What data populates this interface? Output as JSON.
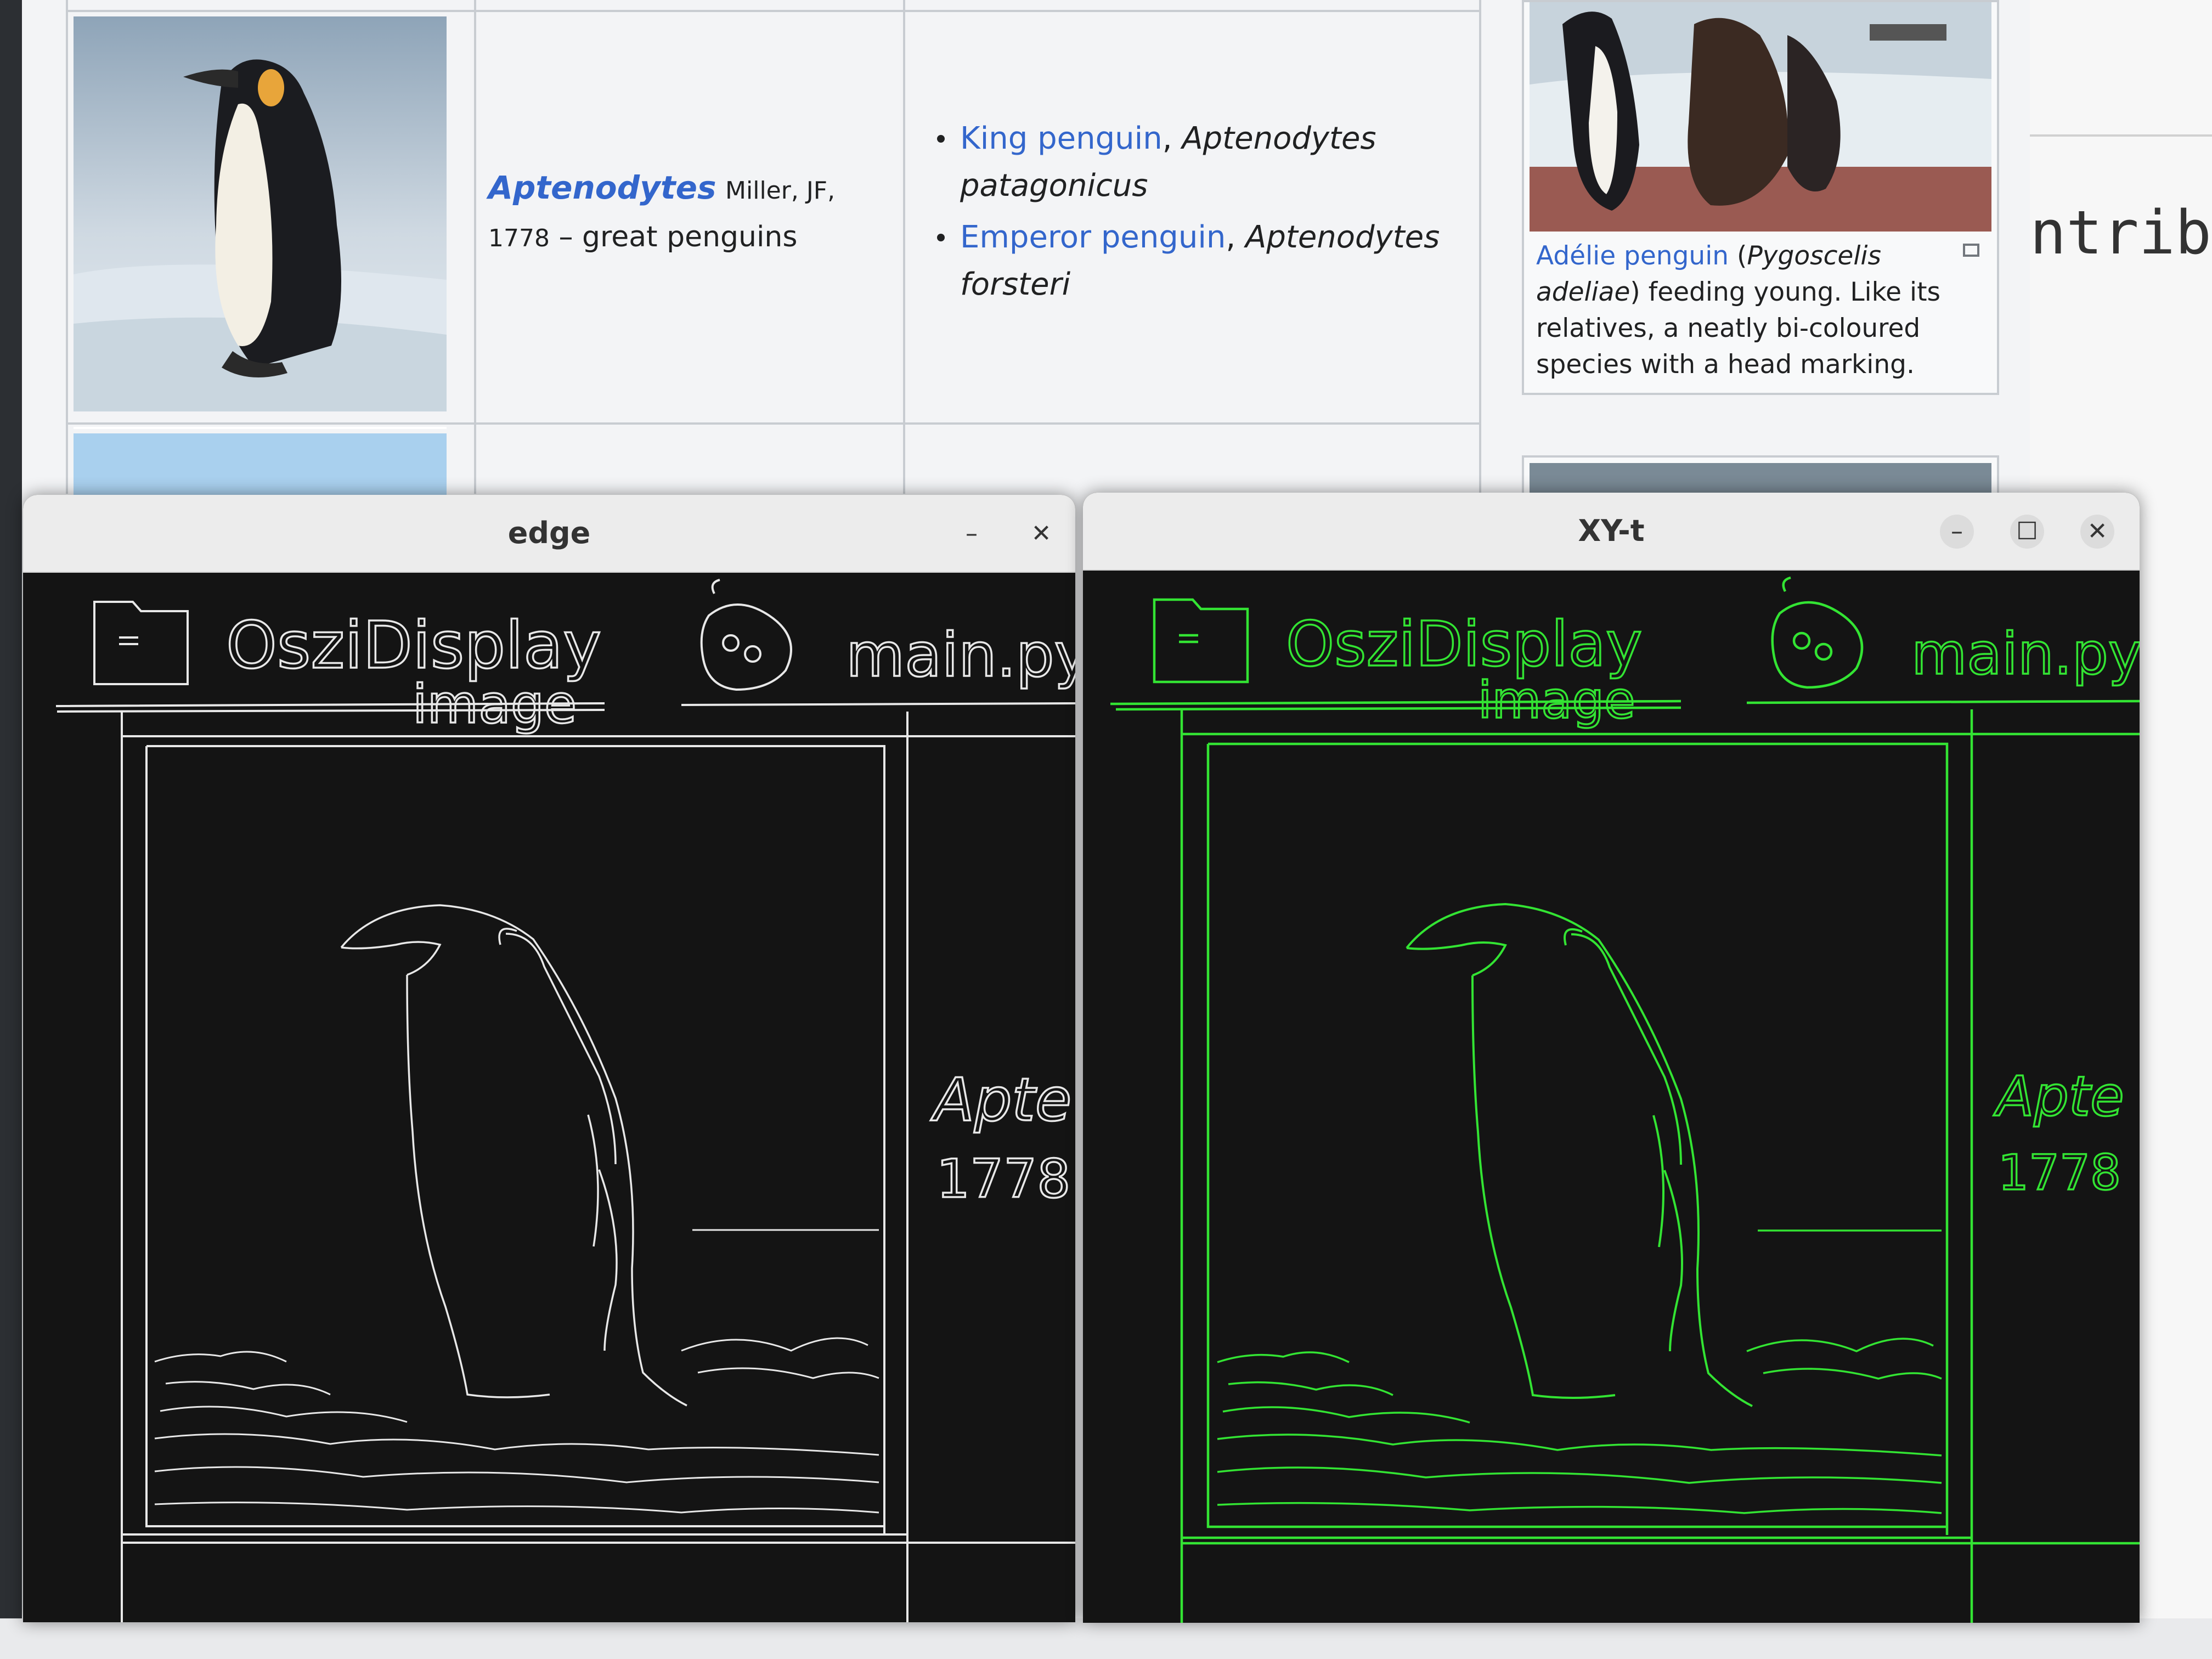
{
  "wiki": {
    "genus": {
      "name": "Aptenodytes",
      "authority": "Miller, JF,",
      "year": "1778",
      "desc": "– great penguins"
    },
    "species": [
      {
        "link": "King penguin",
        "sci_a": "Aptenodytes",
        "sci_b": "patagonicus"
      },
      {
        "link": "Emperor penguin",
        "sci_a": "Aptenodytes",
        "sci_b": "forsteri"
      }
    ],
    "thumb_caption": {
      "link": "Adélie penguin",
      "sci": "Pygoscelis adeliae",
      "rest": "feeding young. Like its relatives, a neatly bi-coloured species with a head marking."
    },
    "side_text": "ntribu"
  },
  "windows": {
    "edge": {
      "title": "edge",
      "controls": {
        "minimize": "–",
        "close": "✕"
      }
    },
    "xyt": {
      "title": "XY-t",
      "controls": {
        "minimize": "–",
        "maximize": "☐",
        "close": "✕"
      }
    }
  },
  "edge_view": {
    "app_name": "OsziDisplay",
    "file_name": "main.py",
    "image_label": "image",
    "genus_fragment": "Apte",
    "year_fragment": "1778",
    "colors": {
      "edge_window": "#e8e8e8",
      "xyt_window": "#33e433"
    }
  },
  "colors": {
    "link": "#3366cc",
    "window_background": "#141414",
    "titlebar": "#ececec"
  }
}
